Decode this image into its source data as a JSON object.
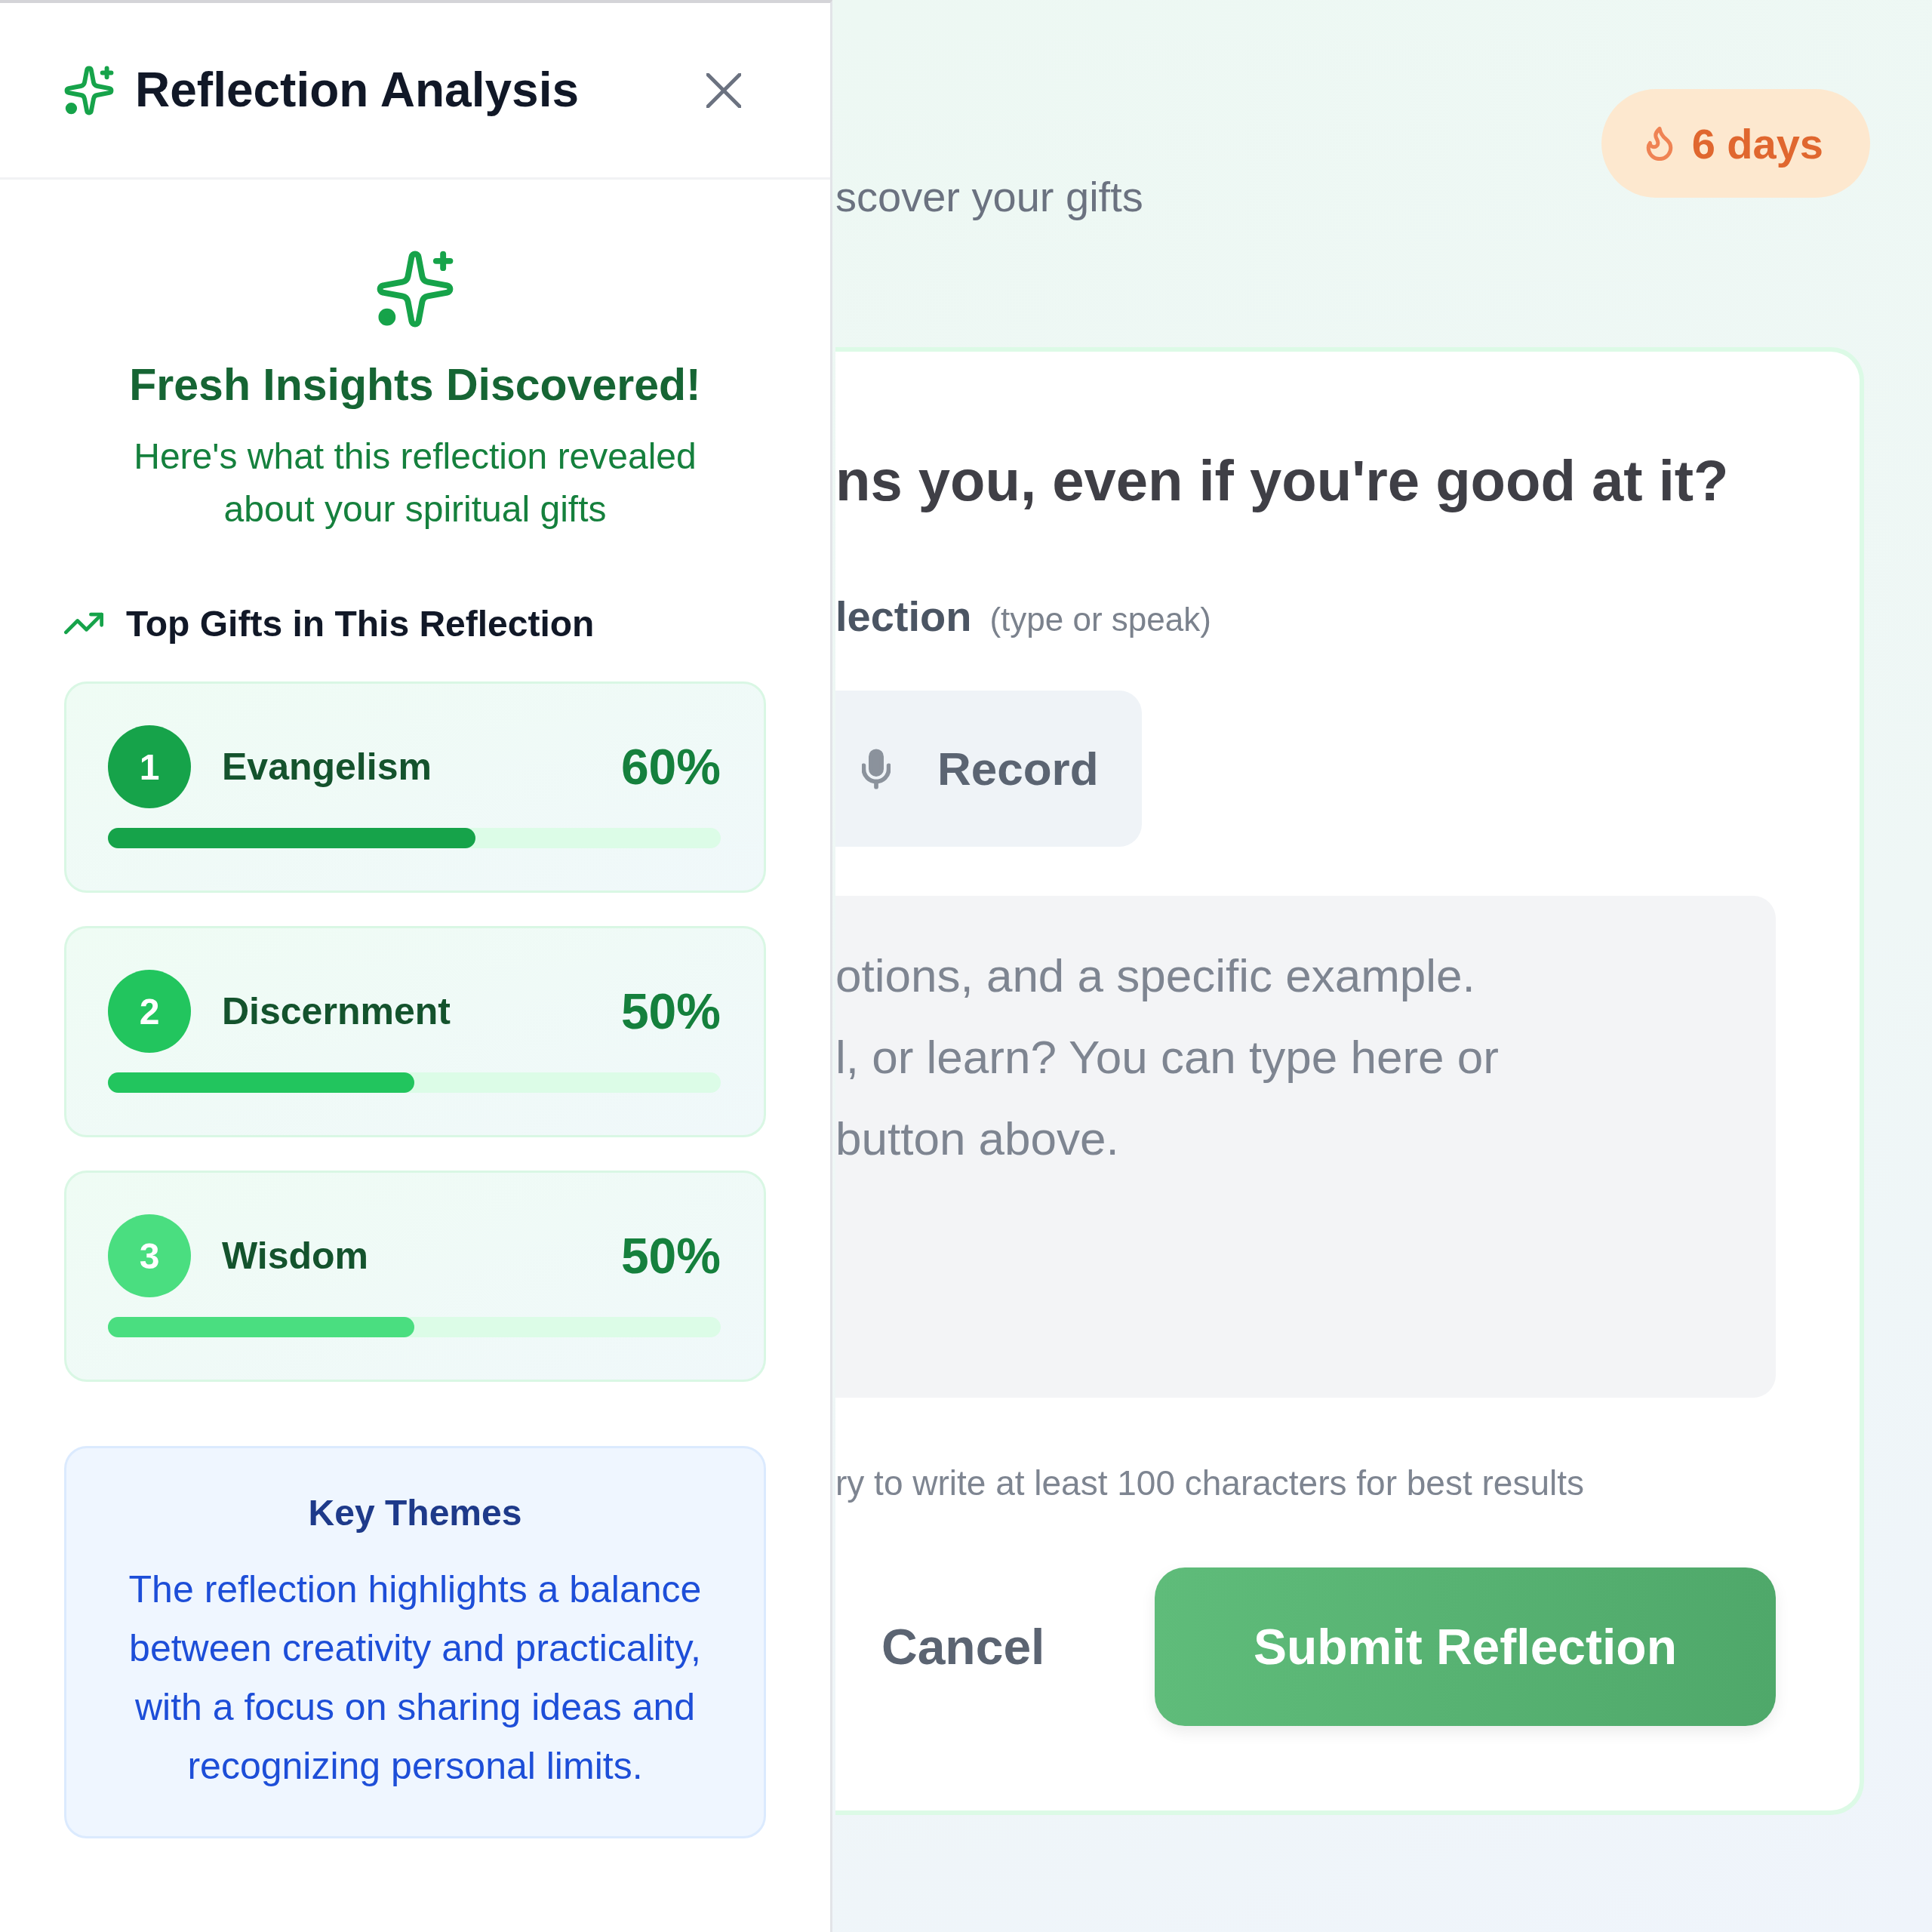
{
  "panel": {
    "title": "Reflection Analysis"
  },
  "hero": {
    "heading": "Fresh Insights Discovered!",
    "subtitle": "Here's what this reflection revealed about your spiritual gifts"
  },
  "top_gifts": {
    "heading": "Top Gifts in This Reflection",
    "gifts": [
      {
        "rank": "1",
        "name": "Evangelism",
        "percent": "60%",
        "level": 0.6,
        "color": "#16a34a"
      },
      {
        "rank": "2",
        "name": "Discernment",
        "percent": "50%",
        "level": 0.5,
        "color": "#22c55e"
      },
      {
        "rank": "3",
        "name": "Wisdom",
        "percent": "50%",
        "level": 0.5,
        "color": "#4ade80"
      }
    ]
  },
  "key_themes": {
    "title": "Key Themes",
    "text": "The reflection highlights a balance between creativity and practicality, with a focus on sharing ideas and recognizing personal limits."
  },
  "background": {
    "subtitle": "scover your gifts",
    "streak": "6 days",
    "question": "ns you, even if you're good at it?",
    "field_label": "lection",
    "field_hint": "(type or speak)",
    "record_button": "Record",
    "answer_field": {
      "placeholder": "otions, and a specific example.\nl, or learn? You can type here or\nbutton above."
    },
    "helper_text": "ry to write at least 100 characters for best results",
    "buttons": [
      {
        "label": "Cancel",
        "kind": "text"
      },
      {
        "label": "Submit Reflection",
        "kind": "primary"
      }
    ]
  }
}
